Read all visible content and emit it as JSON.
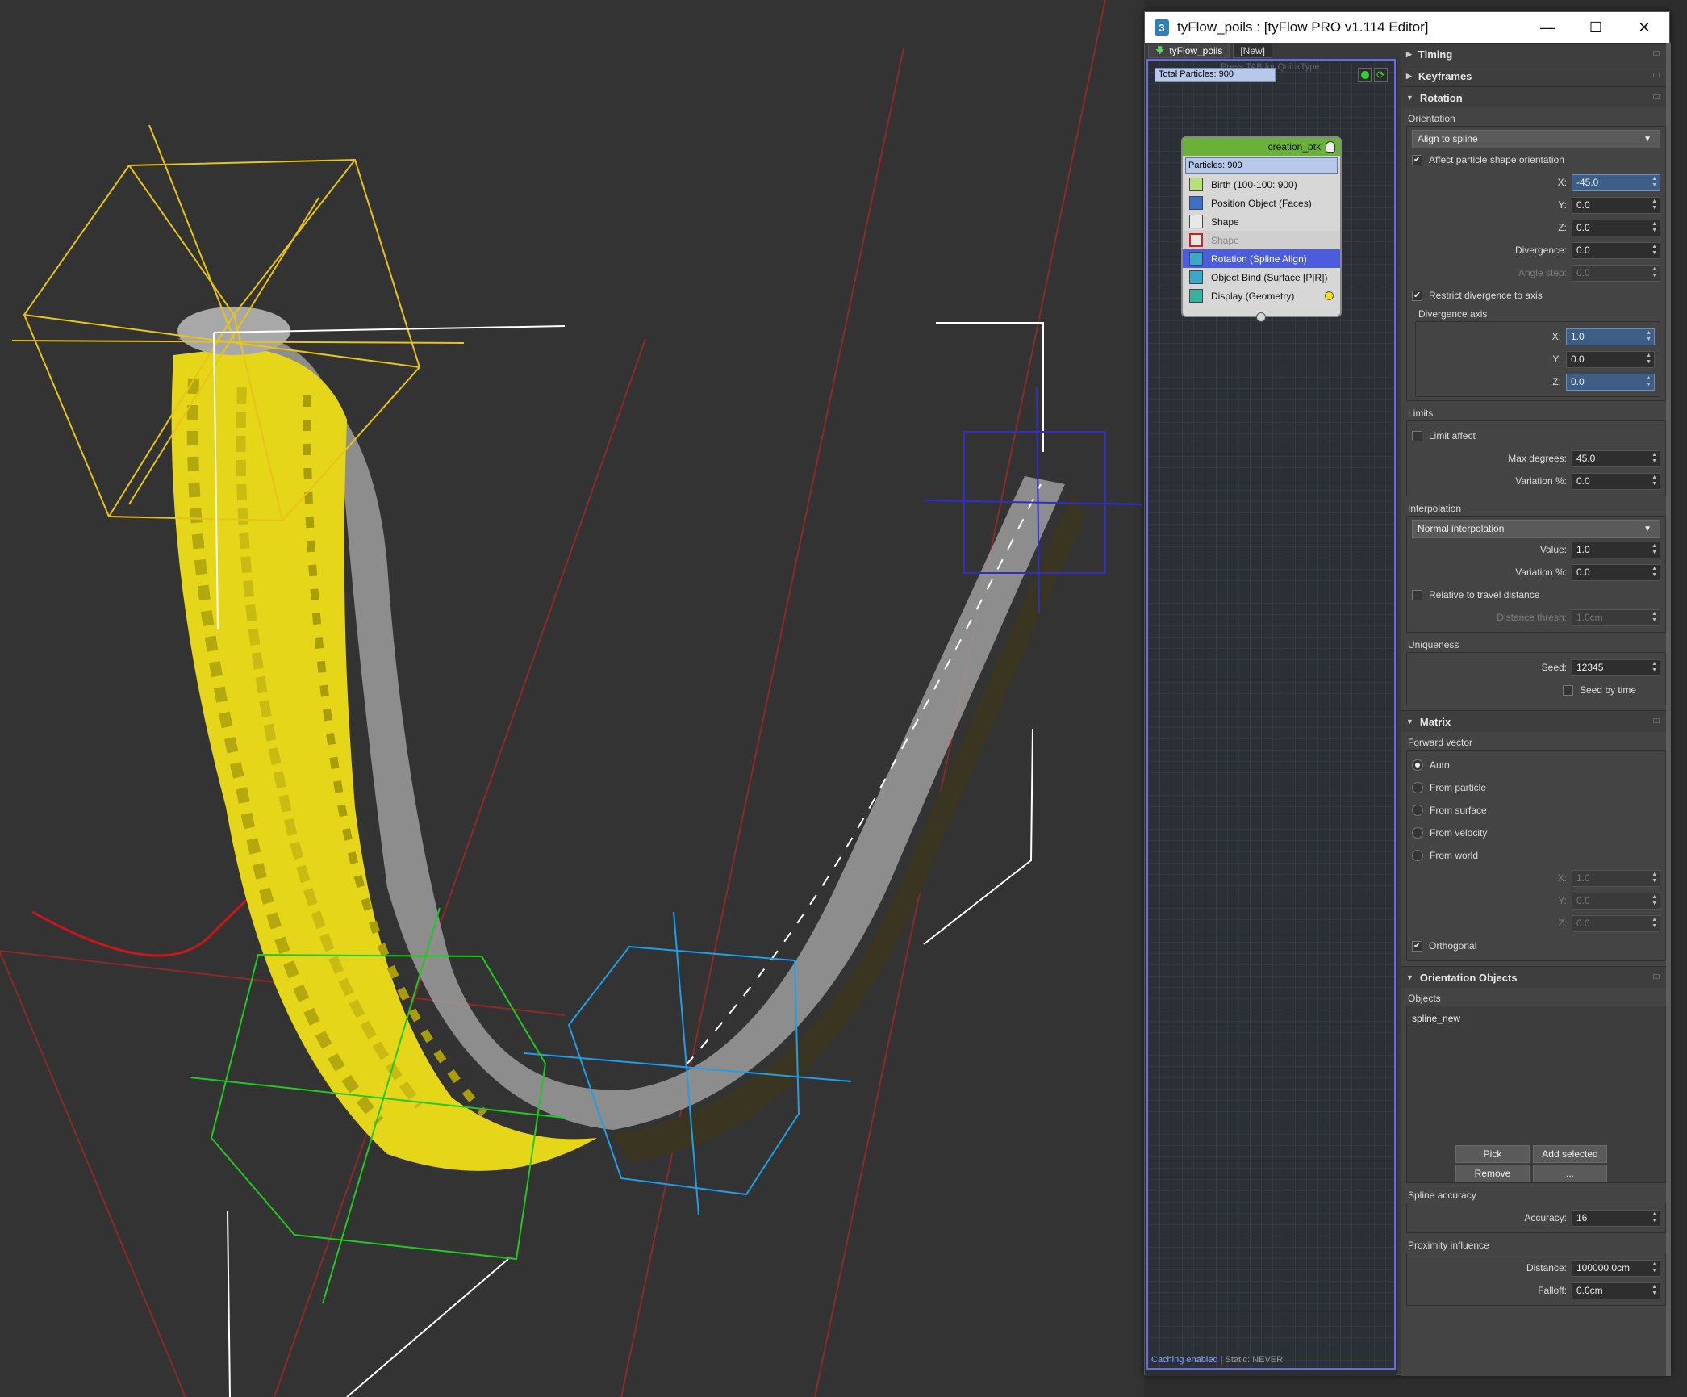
{
  "window": {
    "title": "tyFlow_poils : [tyFlow PRO v1.114 Editor]",
    "minimize": "—",
    "maximize": "☐",
    "close": "✕"
  },
  "flow": {
    "tabs": [
      "tyFlow_poils",
      "[New]"
    ],
    "hint": "Press TAB for QuickType",
    "total_particles": "Total Particles: 900",
    "node": {
      "title": "creation_ptk",
      "particles": "Particles: 900",
      "operators": [
        {
          "label": "Birth (100-100: 900)",
          "icon": "birth-icon"
        },
        {
          "label": "Position Object (Faces)",
          "icon": "position-object-icon"
        },
        {
          "label": "Shape",
          "icon": "shape-icon"
        },
        {
          "label": "Shape",
          "icon": "shape-disabled-icon"
        },
        {
          "label": "Rotation (Spline Align)",
          "icon": "rotation-icon"
        },
        {
          "label": "Object Bind (Surface [P|R])",
          "icon": "object-bind-icon"
        },
        {
          "label": "Display (Geometry)",
          "icon": "display-icon"
        }
      ]
    },
    "caching": "Caching enabled",
    "static": " | Static: NEVER"
  },
  "props": {
    "rollouts": {
      "timing": "Timing",
      "keyframes": "Keyframes",
      "rotation": "Rotation",
      "matrix": "Matrix",
      "orientation_objects": "Orientation Objects"
    },
    "orientation": {
      "label": "Orientation",
      "mode": "Align to spline",
      "affect_shape": "Affect particle shape orientation",
      "x_label": "X:",
      "x": "-45.0",
      "y_label": "Y:",
      "y": "0.0",
      "z_label": "Z:",
      "z": "0.0",
      "divergence_label": "Divergence:",
      "divergence": "0.0",
      "angle_step_label": "Angle step:",
      "angle_step": "0.0",
      "restrict": "Restrict divergence to axis",
      "div_axis_label": "Divergence axis",
      "ax_label": "X:",
      "ax": "1.0",
      "ay_label": "Y:",
      "ay": "0.0",
      "az_label": "Z:",
      "az": "0.0"
    },
    "limits": {
      "label": "Limits",
      "limit_affect": "Limit affect",
      "max_deg_label": "Max degrees:",
      "max_deg": "45.0",
      "variation_label": "Variation %:",
      "variation": "0.0"
    },
    "interpolation": {
      "label": "Interpolation",
      "mode": "Normal interpolation",
      "value_label": "Value:",
      "value": "1.0",
      "variation_label": "Variation %:",
      "variation": "0.0",
      "relative": "Relative to travel distance",
      "dist_label": "Distance thresh:",
      "dist": "1.0cm"
    },
    "uniqueness": {
      "label": "Uniqueness",
      "seed_label": "Seed:",
      "seed": "12345",
      "seed_time": "Seed by time"
    },
    "matrix": {
      "forward_label": "Forward vector",
      "options": [
        "Auto",
        "From particle",
        "From surface",
        "From velocity",
        "From world"
      ],
      "x_label": "X:",
      "x": "1.0",
      "y_label": "Y:",
      "y": "0.0",
      "z_label": "Z:",
      "z": "0.0",
      "orthogonal": "Orthogonal"
    },
    "objects": {
      "label": "Objects",
      "items": [
        "spline_new"
      ],
      "pick": "Pick",
      "add_selected": "Add selected",
      "remove": "Remove",
      "more": "..."
    },
    "spline_accuracy": {
      "label": "Spline accuracy",
      "accuracy_label": "Accuracy:",
      "accuracy": "16"
    },
    "proximity": {
      "label": "Proximity influence",
      "distance_label": "Distance:",
      "distance": "100000.0cm",
      "falloff_label": "Falloff:",
      "falloff": "0.0cm"
    }
  }
}
